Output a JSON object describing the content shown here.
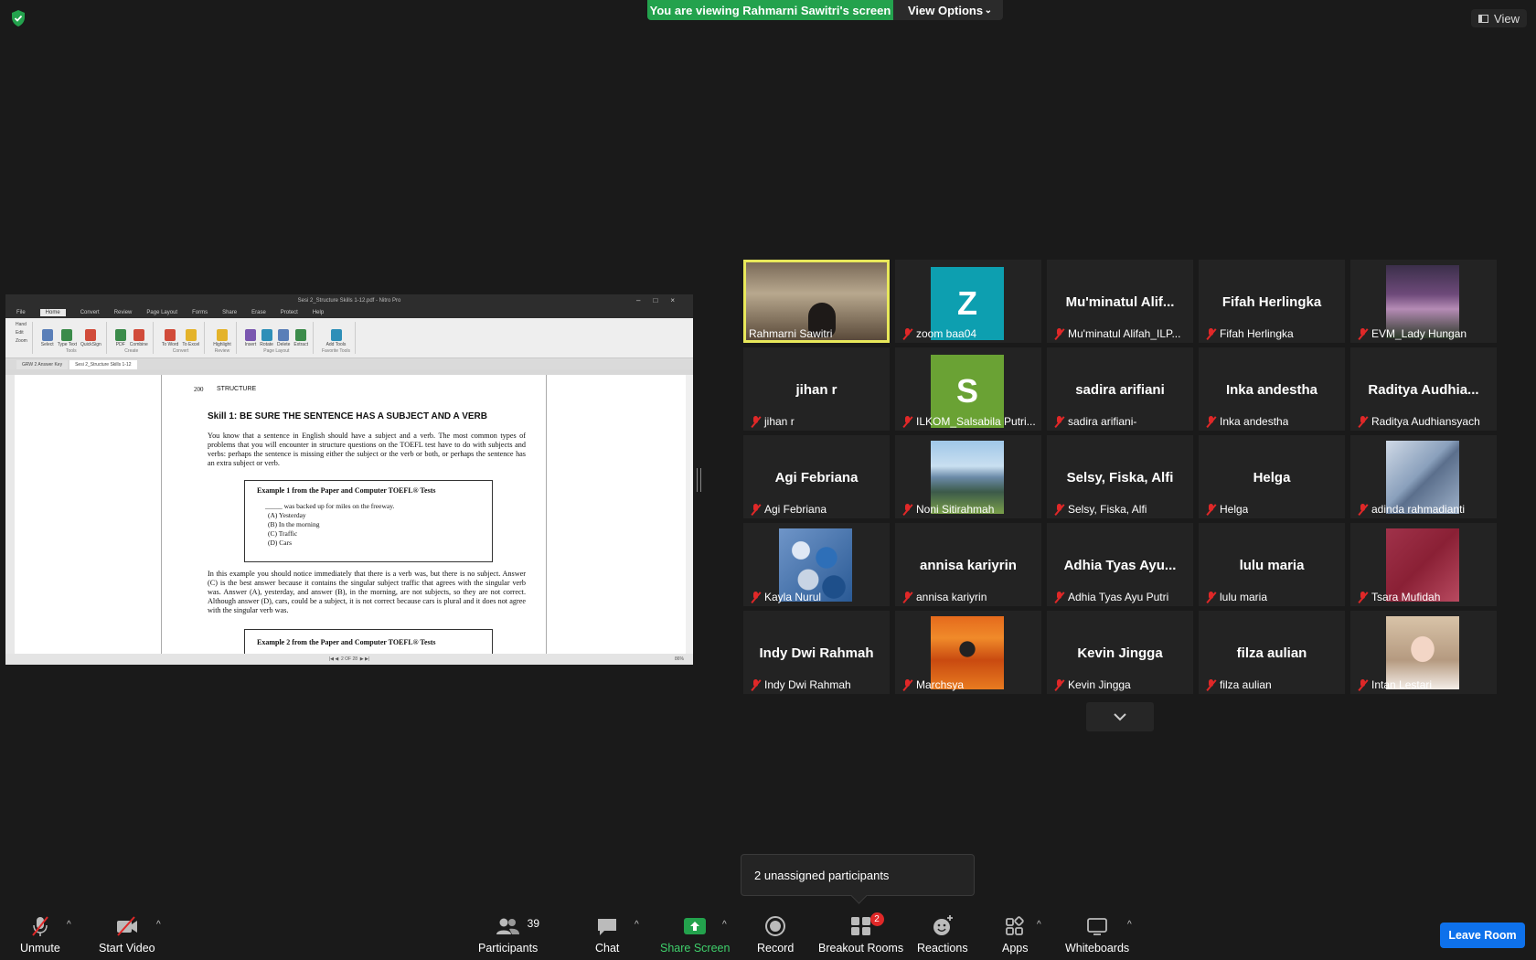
{
  "banner": {
    "viewing": "You are viewing Rahmarni Sawitri's screen",
    "view_options": "View Options",
    "view": "View"
  },
  "nitro": {
    "title": "Sesi 2_Structure Skills 1-12.pdf - Nitro Pro",
    "menu": [
      "File",
      "Home",
      "Convert",
      "Review",
      "Page Layout",
      "Forms",
      "Share",
      "Erase",
      "Protect",
      "Help"
    ],
    "ribbon_groups": [
      {
        "label": "Tools",
        "buttons": [
          "Select",
          "Type Text",
          "QuickSign"
        ]
      },
      {
        "label": "Create",
        "buttons": [
          "PDF",
          "Combine"
        ]
      },
      {
        "label": "Convert",
        "buttons": [
          "To Word",
          "To Excel"
        ]
      },
      {
        "label": "Review",
        "buttons": [
          "Highlight"
        ]
      },
      {
        "label": "Page Layout",
        "buttons": [
          "Insert",
          "Rotate",
          "Delete",
          "Extract"
        ]
      },
      {
        "label": "Favorite Tools",
        "buttons": [
          "Add Tools"
        ]
      }
    ],
    "side_tools": [
      "Hand",
      "Edit",
      "Zoom"
    ],
    "tabs": [
      "GRW 2 Answer Key",
      "Sesi 2_Structure Skills 1-12"
    ],
    "status_page": "2 OF 28",
    "status_zoom": "86%",
    "page": {
      "number": "200",
      "section": "STRUCTURE",
      "skill_heading": "Skill 1:   BE SURE THE SENTENCE HAS A SUBJECT AND A VERB",
      "para1": "You know that a sentence in English should have a subject and a verb. The most common types of problems that you will encounter in structure questions on the TOEFL test have to do with subjects and verbs: perhaps the sentence is missing either the subject or the verb or both, or perhaps the sentence has an extra subject or verb.",
      "example1_title": "Example 1 from the Paper and Computer TOEFL® Tests",
      "example1_question": "_____ was backed up for miles on the freeway.",
      "example1_options": [
        "(A)   Yesterday",
        "(B)   In the morning",
        "(C)   Traffic",
        "(D)   Cars"
      ],
      "para2": "In this example you should notice immediately that there is a verb was, but there is no subject. Answer (C) is the best answer because it contains the singular subject traffic that agrees with the singular verb was. Answer (A), yesterday, and answer (B), in the morning, are not subjects, so they are not correct. Although answer (D), cars, could be a subject, it is not correct because cars is plural and it does not agree with the singular verb was.",
      "example2_title": "Example 2 from the Paper and Computer TOEFL® Tests"
    }
  },
  "participants": [
    {
      "big": "",
      "label": "Rahmarni Sawitri",
      "muted": false,
      "kind": "video",
      "active": true
    },
    {
      "big": "Z",
      "label": "zoom baa04",
      "muted": true,
      "kind": "avatar",
      "color": "#0d9fb0"
    },
    {
      "big": "Mu'minatul  Alif...",
      "label": "Mu'minatul Alifah_ILP...",
      "muted": true,
      "kind": "name"
    },
    {
      "big": "Fifah Herlingka",
      "label": "Fifah Herlingka",
      "muted": true,
      "kind": "name"
    },
    {
      "big": "",
      "label": "EVM_Lady Hungan",
      "muted": true,
      "kind": "photo",
      "photo": "flowers"
    },
    {
      "big": "jihan r",
      "label": "jihan r",
      "muted": true,
      "kind": "name"
    },
    {
      "big": "S",
      "label": "ILKOM_Salsabila Putri...",
      "muted": true,
      "kind": "avatar",
      "color": "#6aa234"
    },
    {
      "big": "sadira arifiani",
      "label": "sadira arifiani-",
      "muted": true,
      "kind": "name"
    },
    {
      "big": "Inka andestha",
      "label": "Inka andestha",
      "muted": true,
      "kind": "name"
    },
    {
      "big": "Raditya  Audhia...",
      "label": "Raditya Audhiansyach",
      "muted": true,
      "kind": "name"
    },
    {
      "big": "Agi Febriana",
      "label": "Agi Febriana",
      "muted": true,
      "kind": "name"
    },
    {
      "big": "",
      "label": "Noni Sitirahmah",
      "muted": true,
      "kind": "photo",
      "photo": "mountain"
    },
    {
      "big": "Selsy, Fiska, Alfi",
      "label": "Selsy, Fiska, Alfi",
      "muted": true,
      "kind": "name"
    },
    {
      "big": "Helga",
      "label": "Helga",
      "muted": true,
      "kind": "name"
    },
    {
      "big": "",
      "label": "adinda rahmadianti",
      "muted": true,
      "kind": "photo",
      "photo": "building"
    },
    {
      "big": "",
      "label": "Kayla Nurul",
      "muted": true,
      "kind": "photo",
      "photo": "balloons"
    },
    {
      "big": "annisa kariyrin",
      "label": "annisa kariyrin",
      "muted": true,
      "kind": "name"
    },
    {
      "big": "Adhia Tyas Ayu...",
      "label": "Adhia Tyas Ayu Putri",
      "muted": true,
      "kind": "name"
    },
    {
      "big": "lulu maria",
      "label": "lulu maria",
      "muted": true,
      "kind": "name"
    },
    {
      "big": "",
      "label": "Tsara Mufidah",
      "muted": true,
      "kind": "photo",
      "photo": "blur"
    },
    {
      "big": "Indy Dwi Rahmah",
      "label": "Indy Dwi Rahmah",
      "muted": true,
      "kind": "name"
    },
    {
      "big": "",
      "label": "Marchsya",
      "muted": true,
      "kind": "photo",
      "photo": "oranges"
    },
    {
      "big": "Kevin Jingga",
      "label": "Kevin Jingga",
      "muted": true,
      "kind": "name"
    },
    {
      "big": "filza aulian",
      "label": "filza aulian",
      "muted": true,
      "kind": "name"
    },
    {
      "big": "",
      "label": "Intan Lestari",
      "muted": true,
      "kind": "photo",
      "photo": "selfie"
    }
  ],
  "unassigned": "2 unassigned participants",
  "toolbar": {
    "unmute": "Unmute",
    "start_video": "Start Video",
    "participants": "Participants",
    "participants_count": "39",
    "chat": "Chat",
    "share_screen": "Share Screen",
    "record": "Record",
    "breakout_rooms": "Breakout Rooms",
    "breakout_badge": "2",
    "reactions": "Reactions",
    "apps": "Apps",
    "whiteboards": "Whiteboards",
    "leave_room": "Leave Room"
  },
  "colors": {
    "share_green": "#23a24d",
    "leave_blue": "#0e71eb",
    "mute_red": "#e02828",
    "active_speaker": "#e8e85a"
  }
}
